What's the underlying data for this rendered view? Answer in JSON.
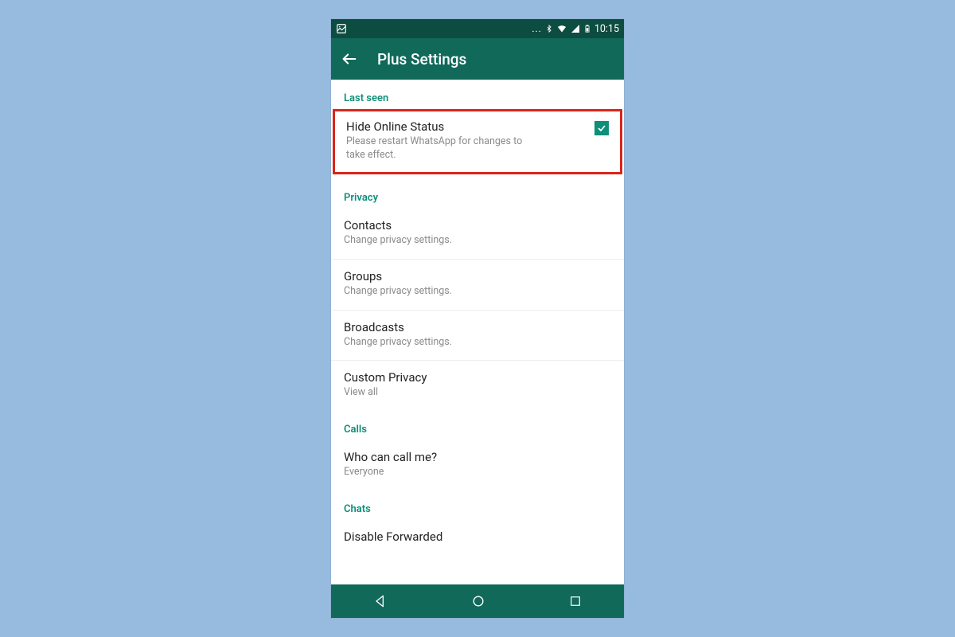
{
  "statusbar": {
    "time": "10:15",
    "dots": "..."
  },
  "appbar": {
    "title": "Plus Settings"
  },
  "sections": {
    "last_seen": {
      "header": "Last seen",
      "hide_online": {
        "title": "Hide Online Status",
        "subtitle": "Please restart WhatsApp for changes to take effect."
      }
    },
    "privacy": {
      "header": "Privacy",
      "contacts": {
        "title": "Contacts",
        "subtitle": "Change privacy settings."
      },
      "groups": {
        "title": "Groups",
        "subtitle": "Change privacy settings."
      },
      "broadcasts": {
        "title": "Broadcasts",
        "subtitle": "Change privacy settings."
      },
      "custom": {
        "title": "Custom Privacy",
        "subtitle": "View all"
      }
    },
    "calls": {
      "header": "Calls",
      "who": {
        "title": "Who can call me?",
        "subtitle": "Everyone"
      }
    },
    "chats": {
      "header": "Chats",
      "disable_forwarded": {
        "title": "Disable Forwarded"
      }
    }
  }
}
